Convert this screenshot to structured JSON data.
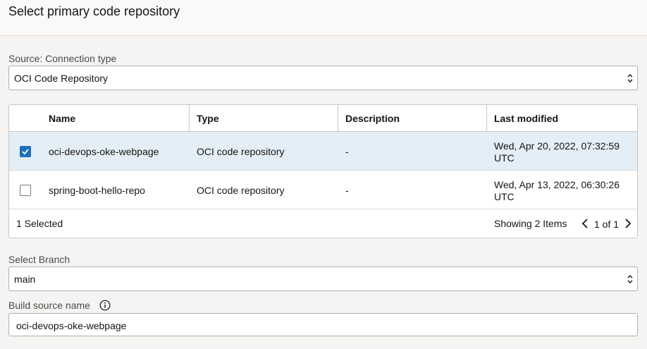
{
  "header": {
    "title": "Select primary code repository"
  },
  "source": {
    "label": "Source: Connection type",
    "value": "OCI Code Repository"
  },
  "table": {
    "columns": [
      "Name",
      "Type",
      "Description",
      "Last modified"
    ],
    "rows": [
      {
        "checked": true,
        "name": "oci-devops-oke-webpage",
        "type": "OCI code repository",
        "description": "-",
        "modified_line1": "Wed, Apr 20, 2022, 07:32:59",
        "modified_line2": "UTC"
      },
      {
        "checked": false,
        "name": "spring-boot-hello-repo",
        "type": "OCI code repository",
        "description": "-",
        "modified_line1": "Wed, Apr 13, 2022, 06:30:26",
        "modified_line2": "UTC"
      }
    ],
    "footer": {
      "selected_text": "1 Selected",
      "showing_text": "Showing 2 Items",
      "page_text": "1 of 1"
    }
  },
  "branch": {
    "label": "Select Branch",
    "value": "main"
  },
  "build_source": {
    "label": "Build source name",
    "value": "oci-devops-oke-webpage",
    "info_icon": "info-icon"
  },
  "colors": {
    "accent": "#1d70b8",
    "selected_row": "#e4eef6"
  }
}
